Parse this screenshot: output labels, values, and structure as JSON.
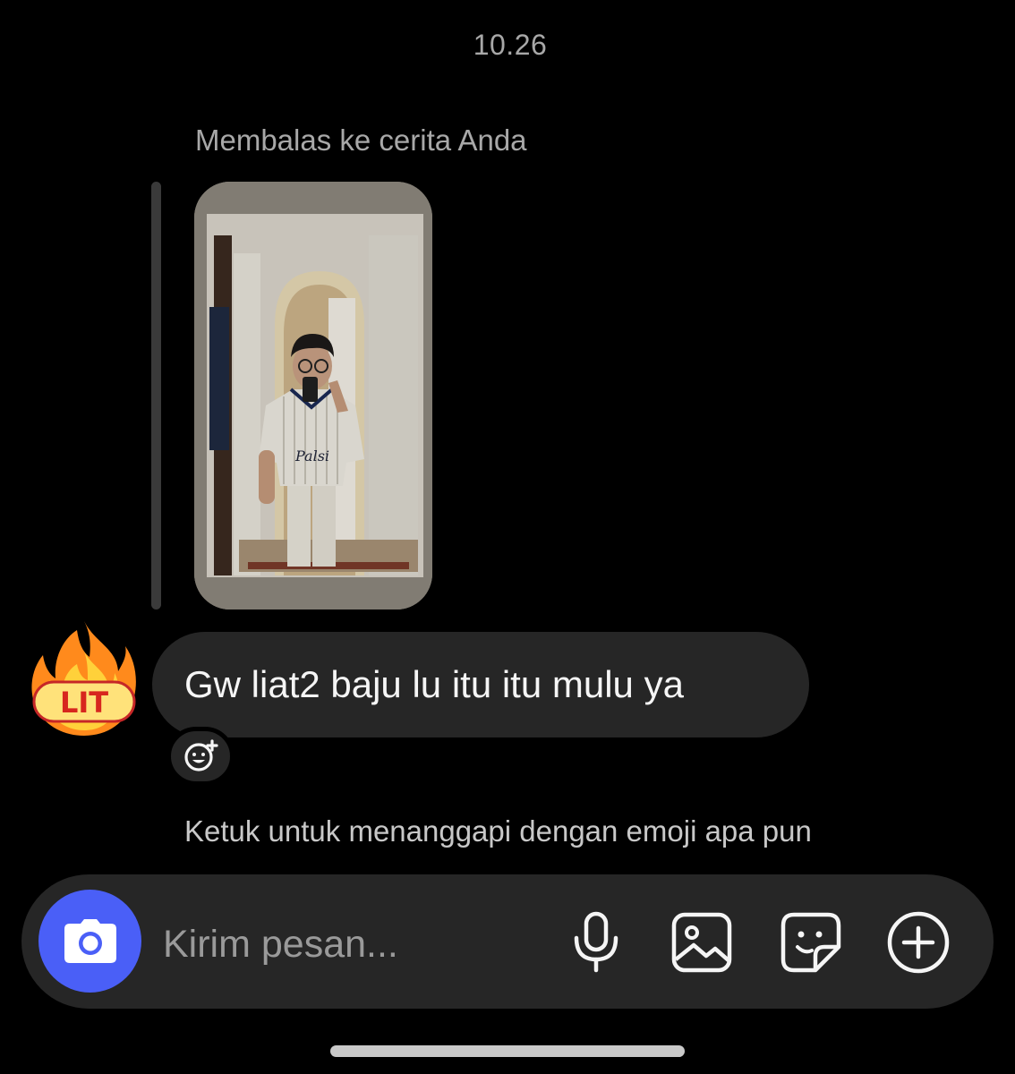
{
  "thread": {
    "timestamp": "10.26",
    "reply_context": "Membalas ke cerita Anda"
  },
  "story": {
    "jersey_text": "Palsi"
  },
  "message": {
    "text": "Gw liat2 baju lu itu itu mulu ya"
  },
  "avatar": {
    "badge_text": "LIT",
    "icon": "fire-lit-sticker-icon"
  },
  "reaction": {
    "icon": "add-reaction-smiley-icon",
    "hint": "Ketuk untuk menanggapi dengan emoji apa pun"
  },
  "composer": {
    "placeholder": "Kirim pesan...",
    "accent_color": "#4a5ff7",
    "icons": [
      "camera-icon",
      "microphone-icon",
      "gallery-icon",
      "sticker-icon",
      "plus-circle-icon"
    ]
  }
}
